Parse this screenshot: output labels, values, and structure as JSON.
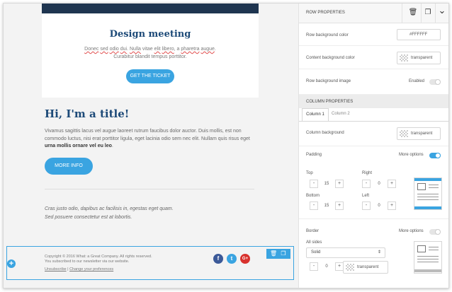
{
  "canvas": {
    "card": {
      "title": "Design meeting",
      "text_line1": [
        "Donec",
        "sed",
        "odio",
        "dui.",
        "Nulla",
        "vitae",
        "elit",
        "libero",
        "a",
        "pharetra",
        "augue."
      ],
      "text_line1_parts": {
        "w1": "Donec",
        "w2": "sed",
        "w3": "odio",
        "w4": "dui",
        "p1": ". ",
        "w5": "Nulla",
        "plain1": " vitae ",
        "w6": "elit",
        "sp": " ",
        "w7": "libero",
        "plain2": ", a ",
        "w8": "pharetra",
        "w9": "augue",
        "p2": "."
      },
      "text_line2": "Curabitur blandit tempus porttitor.",
      "button": "GET THE TICKET"
    },
    "section": {
      "title": "Hi, I'm a title!",
      "paragraph": "Vivamus sagittis lacus vel augue laoreet rutrum faucibus dolor auctor. Duis mollis, est non commodo luctus, nisi erat porttitor ligula, eget lacinia odio sem nec elit. Nullam quis risus eget ",
      "paragraph_bold": "urna mollis ornare vel eu leo",
      "paragraph_end": ".",
      "button": "MORE INFO",
      "quote_line1": "Cras justo odio, dapibus ac facilisis in, egestas eget quam.",
      "quote_line2": "Sed posuere consectetur est at lobortis."
    },
    "footer": {
      "copyright": "Copyright © 2016 What: a Great Company. All rights reserved.",
      "subscribed": "You subscribed to our newsletter via our website.",
      "unsubscribe": "Unsubscribe",
      "separator": "|",
      "preferences": "Change your preferences",
      "social": [
        {
          "name": "facebook",
          "glyph": "f",
          "color": "#3b5998"
        },
        {
          "name": "twitter",
          "glyph": "t",
          "color": "#3aa4e1"
        },
        {
          "name": "google-plus",
          "glyph": "G+",
          "color": "#d8322d"
        }
      ],
      "plus": "+"
    }
  },
  "sidebar": {
    "row_properties": {
      "title": "ROW PROPERTIES",
      "bg_color_label": "Row background color",
      "bg_color_value": "#FFFFFF",
      "content_bg_label": "Content background color",
      "content_bg_value": "transparent",
      "bg_image_label": "Row background image",
      "bg_image_state": "Enabled",
      "bg_image_enabled": false
    },
    "column_properties": {
      "title": "COLUMN PROPERTIES",
      "tabs": [
        "Column 1",
        "Column 2"
      ],
      "active_tab": "Column 1",
      "col_bg_label": "Column background",
      "col_bg_value": "transparent",
      "padding_label": "Padding",
      "more_options": "More options",
      "padding_more_options_enabled": true,
      "top_label": "Top",
      "top_value": "15",
      "right_label": "Right",
      "right_value": "0",
      "bottom_label": "Bottom",
      "bottom_value": "15",
      "left_label": "Left",
      "left_value": "0",
      "border_label": "Border",
      "border_more_options": "More options",
      "border_more_options_enabled": false,
      "all_sides_label": "All sides",
      "border_style": "Solid",
      "border_width": "0",
      "border_color": "transparent"
    }
  },
  "icons": {
    "trash": "🗑",
    "copy": "❐",
    "chevron": "⌄",
    "minus": "-",
    "plus": "+",
    "updown": "⇕"
  },
  "colors": {
    "accent": "#3aa4e1",
    "title": "#1d4a78",
    "hero": "#1f3550"
  }
}
